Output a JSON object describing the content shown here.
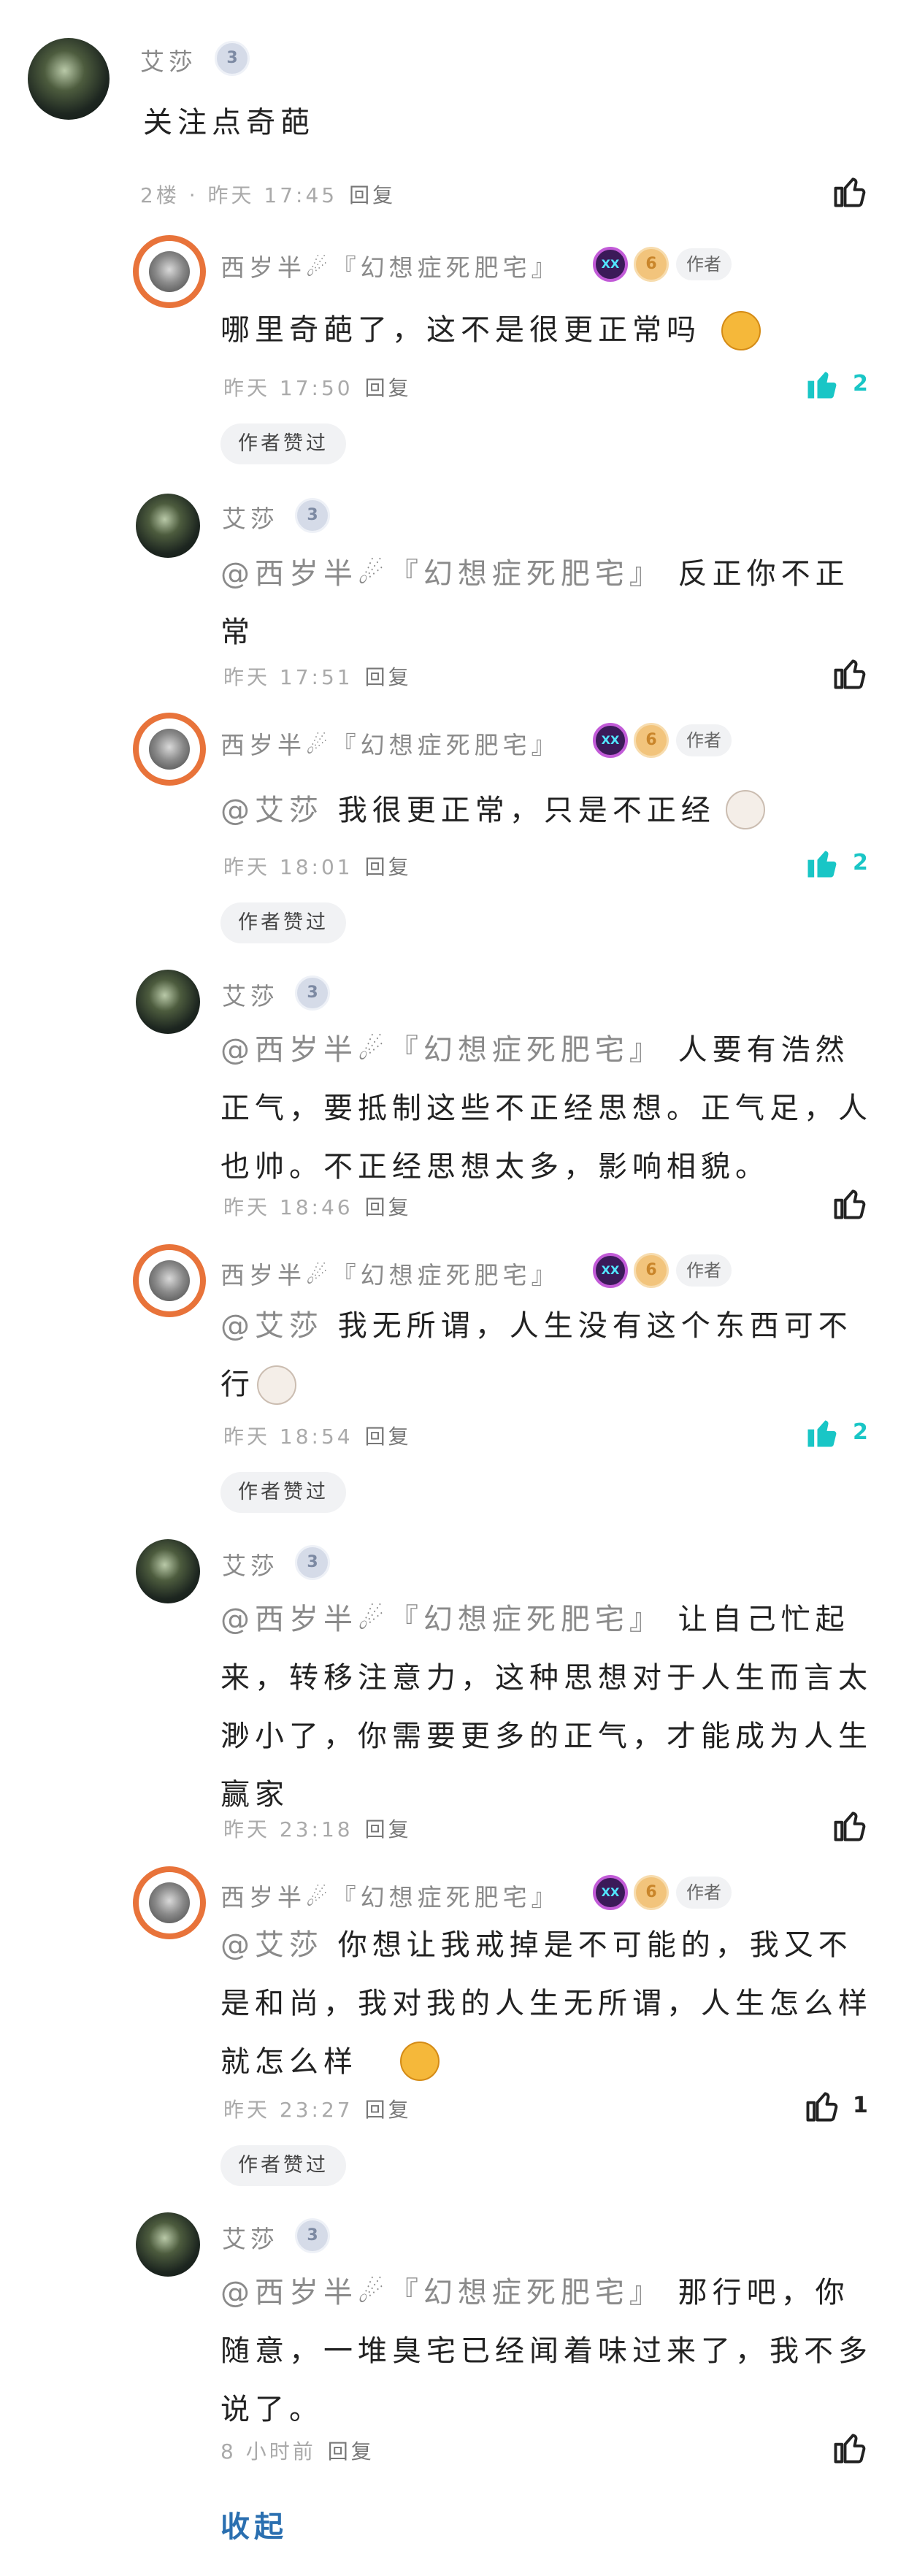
{
  "comments": {
    "c0": {
      "name": "艾莎",
      "level": "3",
      "text": "关注点奇葩",
      "floor_time": "2楼 · 昨天 17:45",
      "reply": "回复"
    },
    "c1": {
      "name": "西岁半☄『幻想症死肥宅』",
      "level": "6",
      "author": "作者",
      "text": "哪里奇葩了，这不是很更正常吗",
      "time": "昨天 17:50",
      "reply": "回复",
      "likes": "2",
      "liked_by_author": "作者赞过"
    },
    "c2": {
      "name": "艾莎",
      "level": "3",
      "mention": "@西岁半☄『幻想症死肥宅』",
      "text": "反正你不正常",
      "time": "昨天 17:51",
      "reply": "回复"
    },
    "c3": {
      "name": "西岁半☄『幻想症死肥宅』",
      "level": "6",
      "author": "作者",
      "mention": "@艾莎",
      "text": "我很更正常，只是不正经",
      "time": "昨天 18:01",
      "reply": "回复",
      "likes": "2",
      "liked_by_author": "作者赞过"
    },
    "c4": {
      "name": "艾莎",
      "level": "3",
      "mention": "@西岁半☄『幻想症死肥宅』",
      "text": "人要有浩然正气，要抵制这些不正经思想。正气足，人也帅。不正经思想太多，影响相貌。",
      "time": "昨天 18:46",
      "reply": "回复"
    },
    "c5": {
      "name": "西岁半☄『幻想症死肥宅』",
      "level": "6",
      "author": "作者",
      "mention": "@艾莎",
      "text": "我无所谓，人生没有这个东西可不行",
      "time": "昨天 18:54",
      "reply": "回复",
      "likes": "2",
      "liked_by_author": "作者赞过"
    },
    "c6": {
      "name": "艾莎",
      "level": "3",
      "mention": "@西岁半☄『幻想症死肥宅』",
      "text": "让自己忙起来，转移注意力，这种思想对于人生而言太渺小了，你需要更多的正气，才能成为人生赢家",
      "time": "昨天 23:18",
      "reply": "回复"
    },
    "c7": {
      "name": "西岁半☄『幻想症死肥宅』",
      "level": "6",
      "author": "作者",
      "mention": "@艾莎",
      "text": "你想让我戒掉是不可能的，我又不是和尚，我对我的人生无所谓，人生怎么样就怎么样",
      "time": "昨天 23:27",
      "reply": "回复",
      "likes": "1",
      "liked_by_author": "作者赞过"
    },
    "c8": {
      "name": "艾莎",
      "level": "3",
      "mention": "@西岁半☄『幻想症死肥宅』",
      "text": "那行吧，你随意，一堆臭宅已经闻着味过来了，我不多说了。",
      "time": "8 小时前",
      "reply": "回复"
    }
  },
  "collapse_label": "收起",
  "colors": {
    "like_active": "#19c6c6",
    "mention": "#8a8a8a",
    "collapse": "#2a6fb0"
  }
}
